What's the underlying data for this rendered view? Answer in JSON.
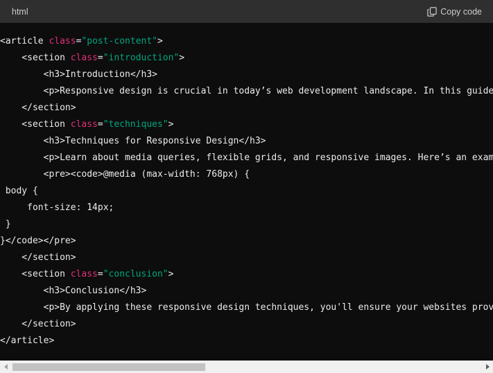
{
  "header": {
    "language": "html",
    "copy_label": "Copy code",
    "copy_icon": "clipboard-icon"
  },
  "code": {
    "lines": [
      [
        {
          "t": "<article "
        },
        {
          "t": "class",
          "k": "attr"
        },
        {
          "t": "="
        },
        {
          "t": "\"post-content\"",
          "k": "str"
        },
        {
          "t": ">"
        }
      ],
      [
        {
          "t": "    <section "
        },
        {
          "t": "class",
          "k": "attr"
        },
        {
          "t": "="
        },
        {
          "t": "\"introduction\"",
          "k": "str"
        },
        {
          "t": ">"
        }
      ],
      [
        {
          "t": "        <h3>Introduction</h3>"
        }
      ],
      [
        {
          "t": "        <p>Responsive design is crucial in today’s web development landscape. In this guide"
        }
      ],
      [
        {
          "t": "    </section>"
        }
      ],
      [
        {
          "t": "    <section "
        },
        {
          "t": "class",
          "k": "attr"
        },
        {
          "t": "="
        },
        {
          "t": "\"techniques\"",
          "k": "str"
        },
        {
          "t": ">"
        }
      ],
      [
        {
          "t": "        <h3>Techniques for Responsive Design</h3>"
        }
      ],
      [
        {
          "t": "        <p>Learn about media queries, flexible grids, and responsive images. Here’s an exam"
        }
      ],
      [
        {
          "t": "        <pre><code>@media (max-width: 768px) {"
        }
      ],
      [
        {
          "t": " body {"
        }
      ],
      [
        {
          "t": "     font-size: 14px;"
        }
      ],
      [
        {
          "t": " }"
        }
      ],
      [
        {
          "t": "}</code></pre>"
        }
      ],
      [
        {
          "t": "    </section>"
        }
      ],
      [
        {
          "t": "    <section "
        },
        {
          "t": "class",
          "k": "attr"
        },
        {
          "t": "="
        },
        {
          "t": "\"conclusion\"",
          "k": "str"
        },
        {
          "t": ">"
        }
      ],
      [
        {
          "t": "        <h3>Conclusion</h3>"
        }
      ],
      [
        {
          "t": "        <p>By applying these responsive design techniques, you'll ensure your websites prov"
        }
      ],
      [
        {
          "t": "    </section>"
        }
      ],
      [
        {
          "t": "</article>"
        }
      ]
    ]
  },
  "scrollbar": {
    "orientation": "horizontal",
    "thumb_fraction": 0.41,
    "scroll_position": 0
  },
  "colors": {
    "background": "#0d0d0d",
    "header_bg": "#2f2f2f",
    "attr": "#df3079",
    "string": "#00a67d",
    "text": "#ececec"
  }
}
